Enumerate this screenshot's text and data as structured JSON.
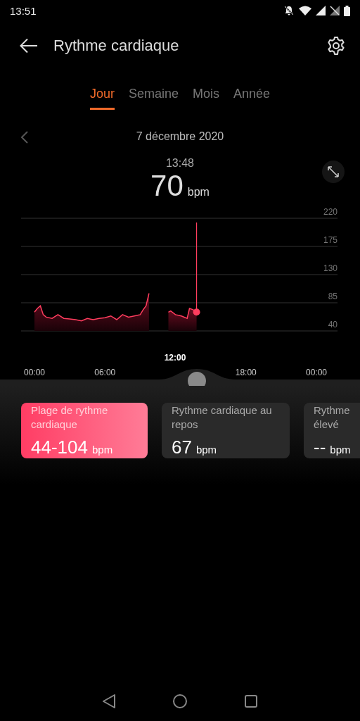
{
  "status_bar": {
    "time": "13:51"
  },
  "header": {
    "title": "Rythme cardiaque"
  },
  "tabs": [
    {
      "label": "Jour",
      "selected": true
    },
    {
      "label": "Semaine",
      "selected": false
    },
    {
      "label": "Mois",
      "selected": false
    },
    {
      "label": "Année",
      "selected": false
    }
  ],
  "date": "7 décembre 2020",
  "reading": {
    "time": "13:48",
    "value": "70",
    "unit": "bpm"
  },
  "chart_data": {
    "type": "area",
    "x": [
      0,
      0.25,
      0.5,
      0.75,
      1,
      1.5,
      2,
      2.5,
      3,
      3.5,
      4,
      4.5,
      5,
      5.5,
      6,
      6.5,
      7,
      7.5,
      8,
      8.5,
      9,
      9.25,
      9.5,
      9.75,
      10,
      11.4,
      11.6,
      12,
      12.5,
      13,
      13.2,
      13.5,
      13.8
    ],
    "series": [
      {
        "color": "#ff3d5e",
        "values": [
          70,
          76,
          80,
          66,
          62,
          60,
          66,
          60,
          59,
          58,
          56,
          60,
          58,
          60,
          61,
          64,
          58,
          66,
          62,
          64,
          66,
          74,
          80,
          100,
          null,
          70,
          72,
          66,
          64,
          60,
          76,
          74,
          70
        ]
      }
    ],
    "xlim": [
      0,
      24
    ],
    "ylim": [
      40,
      220
    ],
    "grid": true,
    "xticks": [
      {
        "value": 0,
        "label": "00:00"
      },
      {
        "value": 6,
        "label": "06:00"
      },
      {
        "value": 18,
        "label": "18:00"
      },
      {
        "value": 24,
        "label": "00:00"
      }
    ],
    "yticks": [
      220,
      175,
      130,
      85,
      40
    ]
  },
  "timeline": {
    "cursor_label": "12:00"
  },
  "cards": [
    {
      "label_lines": [
        "Plage de rythme",
        "cardiaque"
      ],
      "value": "44-104",
      "unit": "bpm",
      "selected": true
    },
    {
      "label_lines": [
        "Rythme cardiaque au",
        "repos"
      ],
      "value": "67",
      "unit": "bpm",
      "selected": false
    },
    {
      "label_lines": [
        "Rythme",
        "élevé"
      ],
      "value": "--",
      "unit": "bpm",
      "selected": false
    }
  ]
}
